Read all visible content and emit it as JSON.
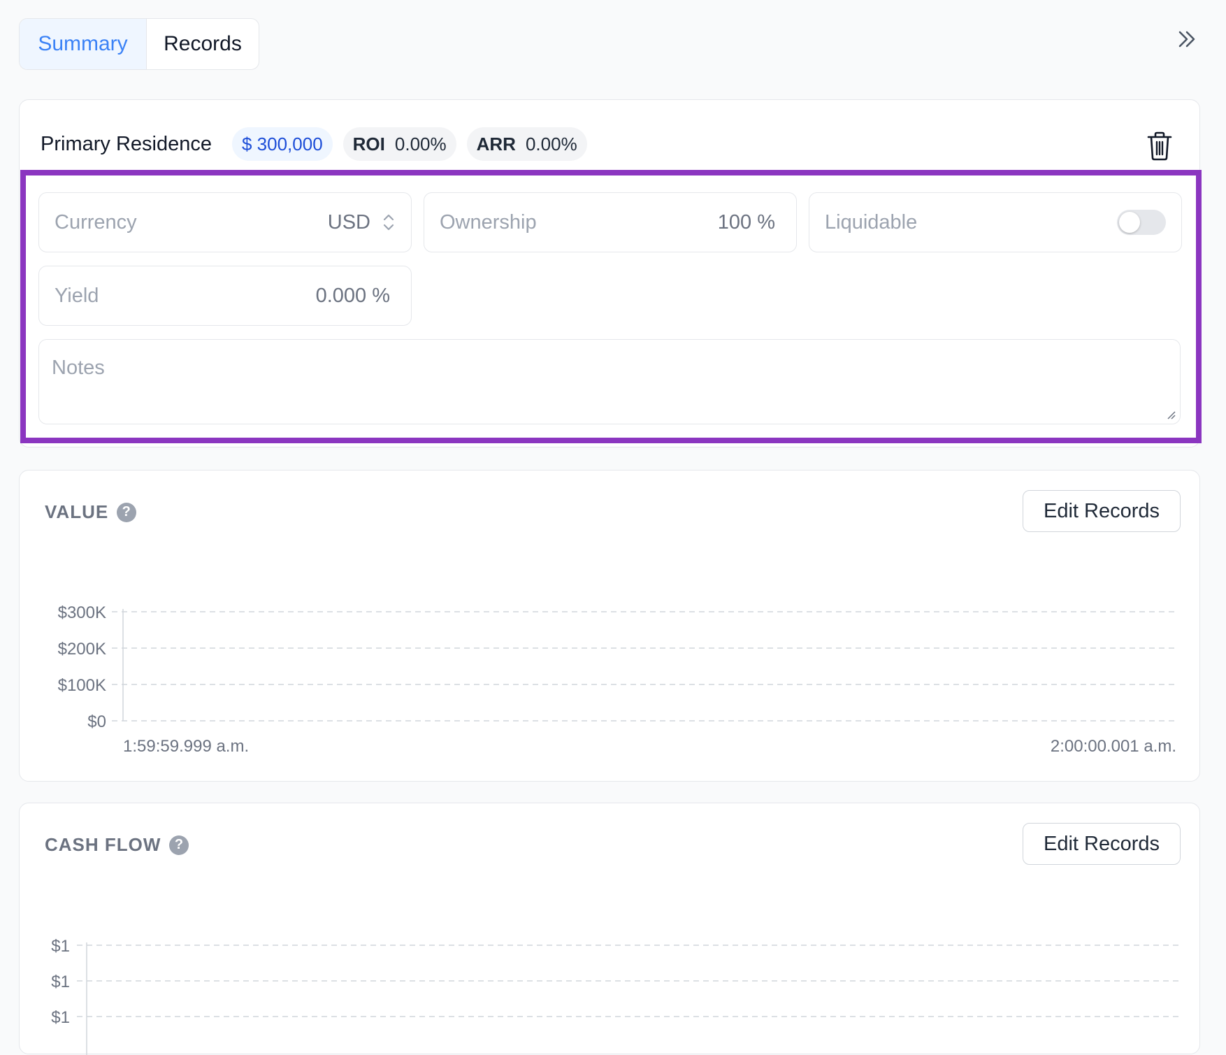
{
  "tabs": [
    {
      "label": "Summary",
      "active": true
    },
    {
      "label": "Records",
      "active": false
    }
  ],
  "header": {
    "collapse_icon": "double-chevron-right-icon"
  },
  "property": {
    "name": "Primary Residence",
    "value": "$ 300,000",
    "roi_label": "ROI",
    "roi_value": "0.00%",
    "arr_label": "ARR",
    "arr_value": "0.00%",
    "delete_icon": "trash-icon"
  },
  "fields": {
    "currency_label": "Currency",
    "currency_value": "USD",
    "ownership_label": "Ownership",
    "ownership_value": "100 %",
    "liquidable_label": "Liquidable",
    "liquidable_on": false,
    "yield_label": "Yield",
    "yield_value": "0.000 %",
    "notes_placeholder": "Notes"
  },
  "value_chart": {
    "title": "VALUE",
    "edit_label": "Edit Records",
    "chart_data": {
      "type": "line",
      "title": "VALUE",
      "y_ticks": [
        "$300K",
        "$200K",
        "$100K",
        "$0"
      ],
      "x_ticks": [
        "1:59:59.999 a.m.",
        "2:00:00.001 a.m."
      ],
      "ylim": [
        0,
        300000
      ],
      "grid": true,
      "series": []
    }
  },
  "cashflow_chart": {
    "title": "CASH FLOW",
    "edit_label": "Edit Records",
    "chart_data": {
      "type": "bar",
      "title": "CASH FLOW",
      "y_ticks": [
        "$1",
        "$1",
        "$1"
      ],
      "grid": true,
      "series": []
    }
  },
  "colors": {
    "accent": "#3b82f6",
    "highlight": "#8b36c0",
    "value_pill": "#1d4ed8"
  }
}
